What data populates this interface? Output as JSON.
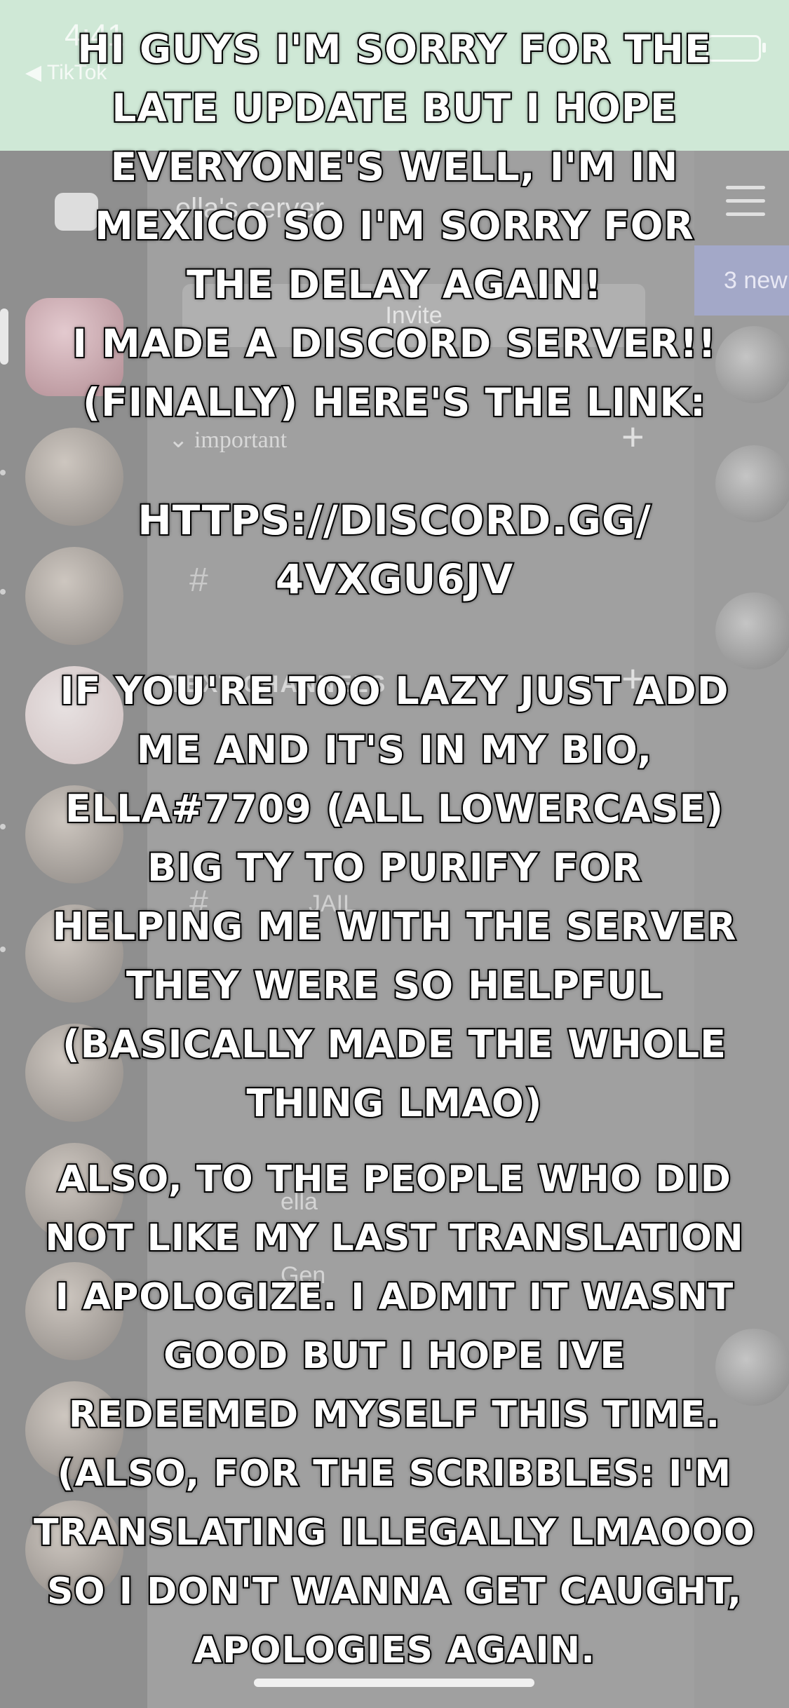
{
  "status_bar": {
    "time": "4:41",
    "back_app": "◀ TikTok"
  },
  "discord_background": {
    "server_name": "ella's server",
    "invite_label": "Invite",
    "category_important": "⌄ important",
    "category_text": "TEXT CHANNELS",
    "channel_jail": "JAIL",
    "new_badge": "3 new",
    "member_names": [
      "ella",
      "Gen"
    ]
  },
  "overlay": {
    "block1": "Hi guys I'm sorry for the\nlate update but I hope\neveryone's well, I'm in\nMexico so I'm sorry for\nthe delay again!\nI made a discord server!!\n(finally) here's the link:",
    "link": "https://discord.gg/\n4vxgu6jv",
    "block3": "If you're too lazy just add\nme and it's in my bio,\nella#7709 (all lowercase)\nBig ty to purify for\nhelping me with the server\nthey were so helpful\n(basically made the whole\nthing lmao)",
    "block4": "Also, to the people who did\nnot like my last translation\nI apologize. I admit it wasnt\ngood but I hope ive\nredeemed myself this time.\n(also, for the scribbles: I'm\ntranslating illegally lmaooo\nso I don't wanna get caught,\napologies again."
  },
  "colors": {
    "status_bar_bg": "#cfe8d6",
    "text_fill": "#ffffff",
    "text_stroke": "#000000"
  }
}
